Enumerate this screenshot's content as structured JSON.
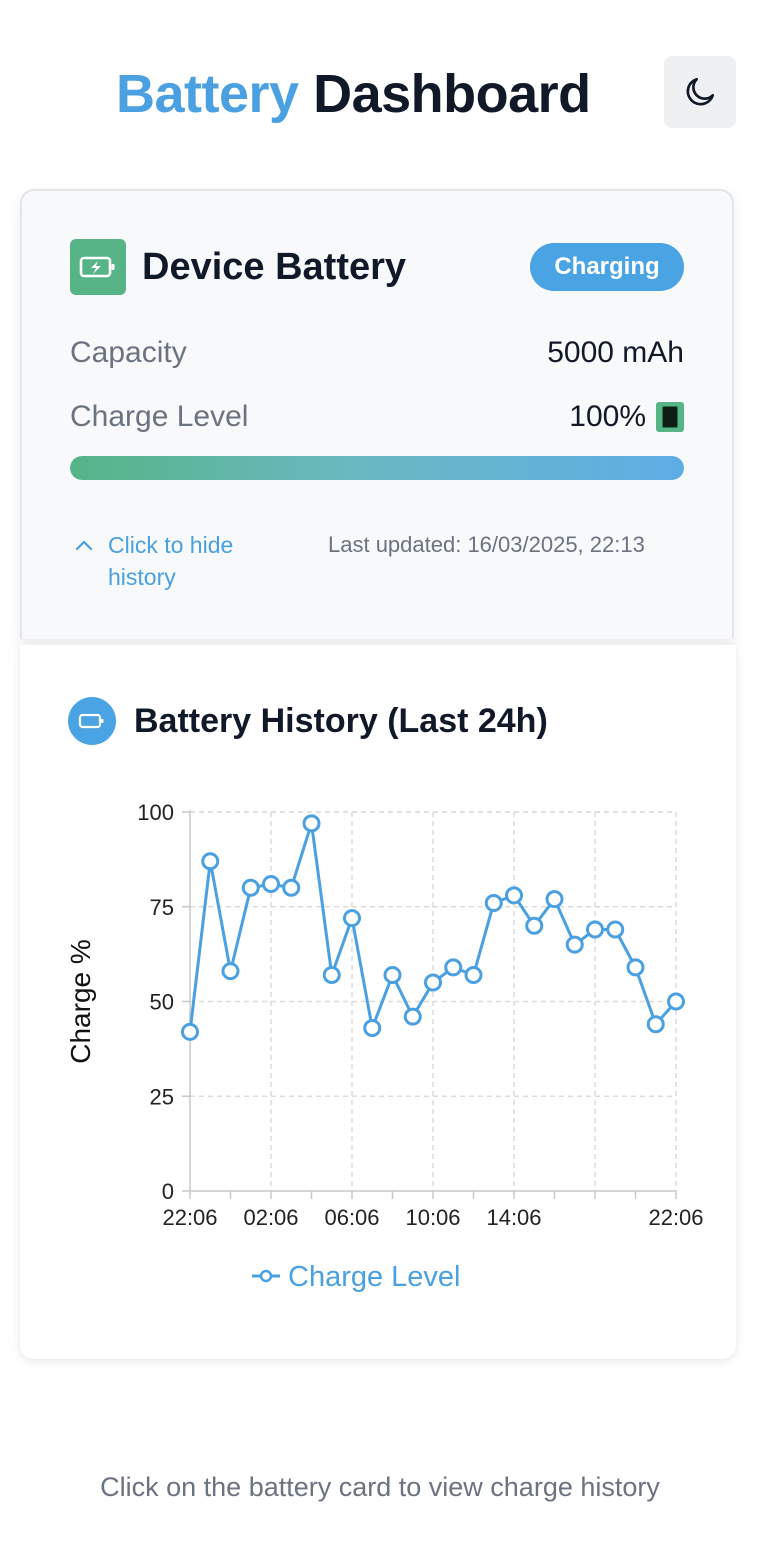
{
  "header": {
    "title_accent": "Battery",
    "title_rest": "Dashboard",
    "theme_toggle_icon": "moon-icon"
  },
  "battery_card": {
    "icon": "battery-charging-icon",
    "title": "Device Battery",
    "status_badge": "Charging",
    "capacity_label": "Capacity",
    "capacity_value": "5000 mAh",
    "charge_label": "Charge Level",
    "charge_value": "100%",
    "charge_fraction": 1.0,
    "toggle_history_label": "Click to hide history",
    "last_updated": "Last updated: 16/03/2025, 22:13"
  },
  "history_card": {
    "icon": "battery-icon",
    "title": "Battery History (Last 24h)"
  },
  "chart_data": {
    "type": "line",
    "ylabel": "Charge %",
    "ylim": [
      0,
      100
    ],
    "yticks": [
      0,
      25,
      50,
      75,
      100
    ],
    "xticks": [
      "22:06",
      "02:06",
      "06:06",
      "10:06",
      "14:06",
      "22:06"
    ],
    "grid": true,
    "legend_position": "bottom",
    "series": [
      {
        "name": "Charge Level",
        "color": "#4aa0e0",
        "values": [
          42,
          87,
          58,
          80,
          81,
          80,
          97,
          57,
          72,
          43,
          57,
          46,
          55,
          59,
          57,
          76,
          78,
          70,
          77,
          65,
          69,
          69,
          59,
          44,
          50
        ]
      }
    ]
  },
  "footer": {
    "note": "Click on the battery card to view charge history"
  },
  "colors": {
    "accent": "#4aa0e0",
    "success": "#56b487",
    "text": "#111827",
    "muted": "#6b7280"
  }
}
